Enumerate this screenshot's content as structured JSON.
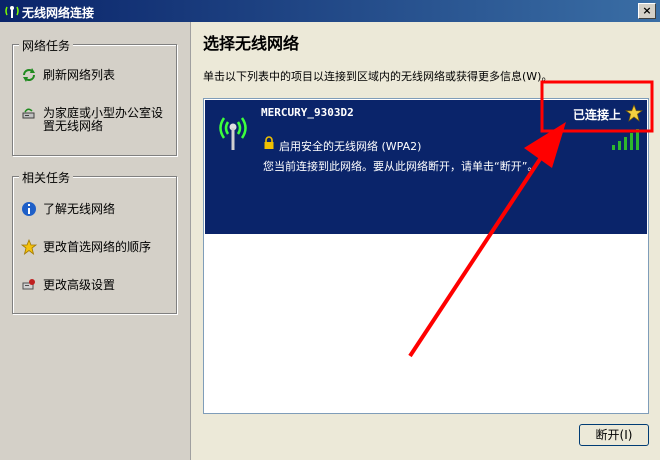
{
  "window": {
    "title": "无线网络连接",
    "close_label": "×"
  },
  "left": {
    "network_tasks": {
      "title": "网络任务",
      "items": [
        {
          "label": "刷新网络列表",
          "icon": "refresh-icon"
        },
        {
          "label_line1": "为家庭或小型办公室设",
          "label_line2": "置无线网络",
          "icon": "home-network-icon"
        }
      ]
    },
    "related_tasks": {
      "title": "相关任务",
      "items": [
        {
          "label": "了解无线网络",
          "icon": "info-icon"
        },
        {
          "label": "更改首选网络的顺序",
          "icon": "star-icon"
        },
        {
          "label": "更改高级设置",
          "icon": "settings-icon"
        }
      ]
    }
  },
  "main": {
    "heading": "选择无线网络",
    "description": "单击以下列表中的项目以连接到区域内的无线网络或获得更多信息(W)。",
    "network": {
      "ssid": "MERCURY_9303D2",
      "status": "已连接上",
      "security": "启用安全的无线网络 (WPA2)",
      "info": "您当前连接到此网络。要从此网络断开，请单击“断开”。",
      "signal_level": 1.0
    },
    "disconnect_label": "断开(I)"
  },
  "colors": {
    "selection": "#0a246a",
    "annotation": "#ff0000",
    "signal": "#2db82d"
  }
}
